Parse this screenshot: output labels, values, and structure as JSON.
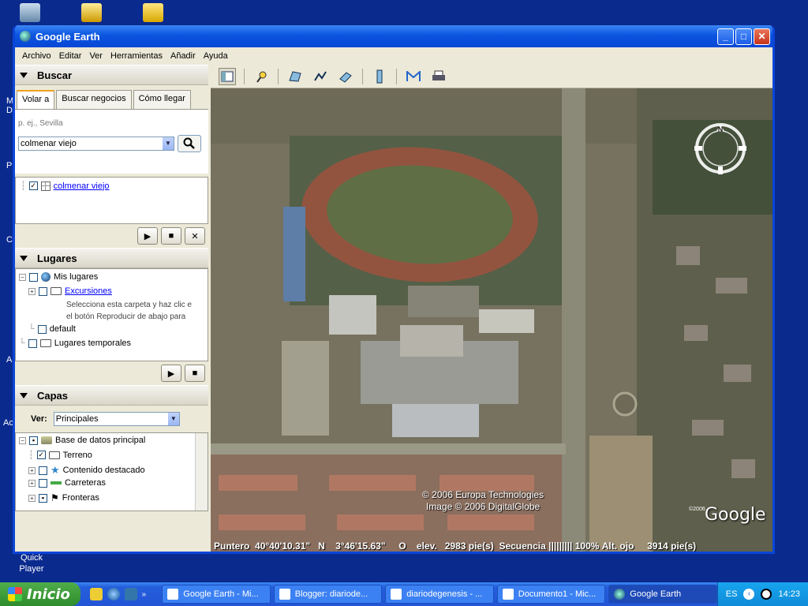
{
  "desktop": {
    "icons": [
      "my-computer-icon",
      "search-shortcut-icon",
      "zip-folder-icon"
    ],
    "partial_labels": [
      "M",
      "D",
      "P",
      "C",
      "A",
      "Ac"
    ],
    "quickplayer_label": "Quick Player"
  },
  "window": {
    "title": "Google Earth",
    "menu": [
      "Archivo",
      "Editar",
      "Ver",
      "Herramientas",
      "Añadir",
      "Ayuda"
    ]
  },
  "search_panel": {
    "header": "Buscar",
    "tabs": [
      "Volar a",
      "Buscar negocios",
      "Cómo llegar"
    ],
    "hint": "p. ej., Sevilla",
    "query": "colmenar viejo",
    "result": "colmenar viejo"
  },
  "places_panel": {
    "header": "Lugares",
    "mis_lugares": "Mis lugares",
    "excursiones": "Excursiones",
    "desc_line1": "Selecciona esta carpeta y haz clic e",
    "desc_line2": "el botón Reproducir de abajo para",
    "default": "default",
    "temporales": "Lugares temporales"
  },
  "layers_panel": {
    "header": "Capas",
    "ver_label": "Ver:",
    "ver_value": "Principales",
    "items": [
      "Base de datos principal",
      "Terreno",
      "Contenido destacado",
      "Carreteras",
      "Fronteras"
    ]
  },
  "map": {
    "copyright_line1": "© 2006 Europa Technologies",
    "copyright_line2": "Image © 2006 DigitalGlobe",
    "logo_text": "Google",
    "logo_prefix": "©2006",
    "compass_letter": "N",
    "status": {
      "puntero": "Puntero",
      "lat": "40°40'10.31\"",
      "lat_dir": "N",
      "lon": "3°46'15.63\"",
      "lon_dir": "O",
      "elev_label": "elev.",
      "elev": "2983 pie(s)",
      "streaming_label": "Secuencia",
      "streaming_bar": "|||||||||",
      "streaming_pct": "100%",
      "alt_label": "Alt. ojo",
      "alt": "3914 pie(s)"
    }
  },
  "taskbar": {
    "start": "Inicio",
    "tasks": [
      "Google Earth - Mi...",
      "Blogger: diariode...",
      "diariodegenesis - ...",
      "Documento1 - Mic...",
      "Google Earth"
    ],
    "lang": "ES",
    "clock": "14:23"
  }
}
